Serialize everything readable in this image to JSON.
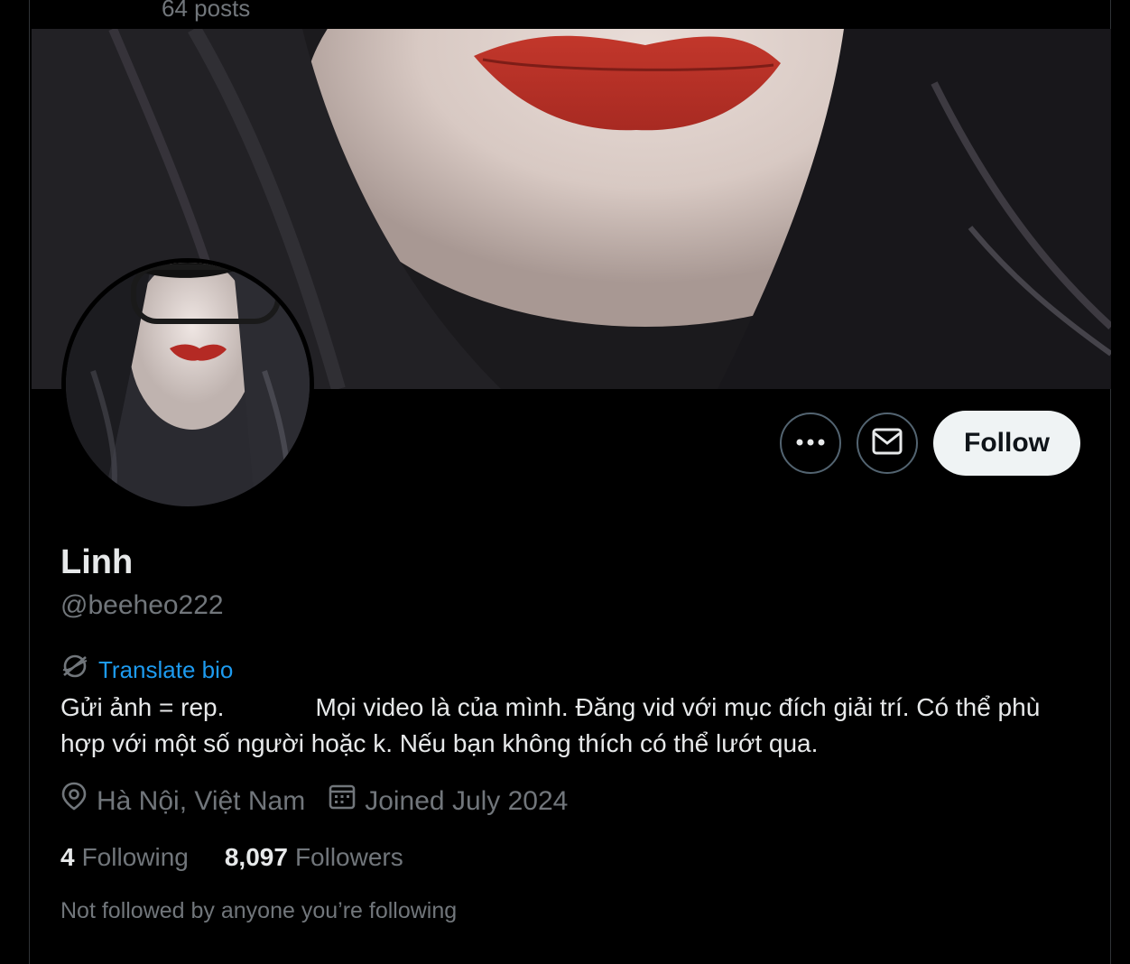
{
  "header": {
    "posts_count": "64 posts"
  },
  "profile": {
    "name": "Linh",
    "handle": "@beeheo222",
    "translate_bio_label": "Translate bio",
    "bio": "Gửi ảnh = rep.             Mọi video là của mình. Đăng vid với mục đích giải trí. Có thể phù hợp với một số người hoặc k. Nếu bạn không thích có thể lướt qua.",
    "location": "Hà Nội, Việt Nam",
    "joined": "Joined July 2024",
    "following_count": "4",
    "following_label": "Following",
    "followers_count": "8,097",
    "followers_label": "Followers",
    "not_followed_text": "Not followed by anyone you’re following"
  },
  "actions": {
    "more_icon": "more-horizontal-icon",
    "message_icon": "envelope-icon",
    "follow_label": "Follow"
  },
  "icons": {
    "translate": "translate-globe-icon",
    "location": "location-pin-icon",
    "calendar": "calendar-icon"
  },
  "colors": {
    "background": "#000000",
    "text_primary": "#e7e9ea",
    "text_secondary": "#71767b",
    "accent": "#1d9bf0",
    "follow_bg": "#eff3f4",
    "border": "#2f3336"
  }
}
